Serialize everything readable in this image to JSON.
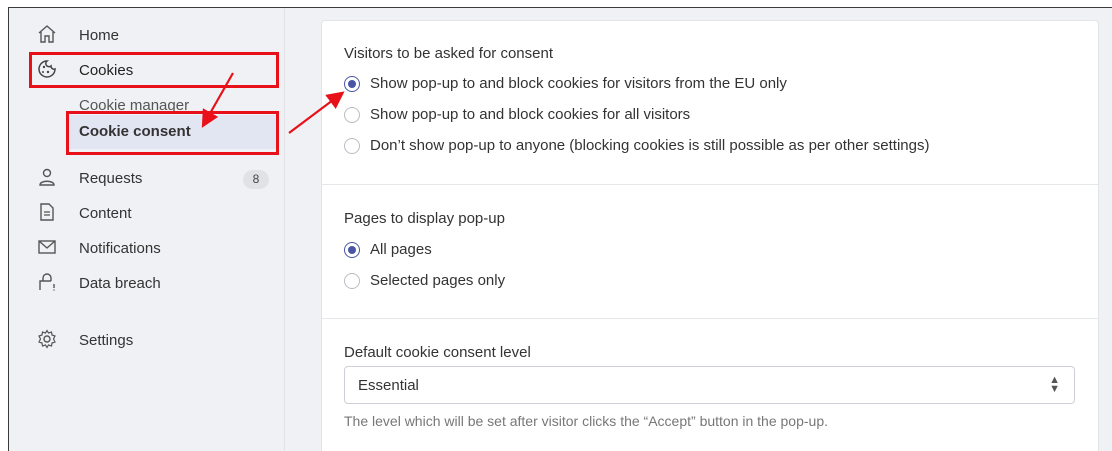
{
  "sidebar": {
    "items": [
      {
        "label": "Home",
        "icon": "home-icon"
      },
      {
        "label": "Cookies",
        "icon": "cookie-icon"
      },
      {
        "label": "Cookie manager"
      },
      {
        "label": "Cookie consent"
      },
      {
        "label": "Requests",
        "icon": "user-icon",
        "badge": "8"
      },
      {
        "label": "Content",
        "icon": "document-icon"
      },
      {
        "label": "Notifications",
        "icon": "envelope-icon"
      },
      {
        "label": "Data breach",
        "icon": "lock-alert-icon"
      },
      {
        "label": "Settings",
        "icon": "gear-icon"
      }
    ]
  },
  "consent": {
    "title": "Visitors to be asked for consent",
    "options": [
      {
        "label": "Show pop-up to and block cookies for visitors from the EU only",
        "selected": true
      },
      {
        "label": "Show pop-up to and block cookies for all visitors",
        "selected": false
      },
      {
        "label": "Don’t show pop-up to anyone (blocking cookies is still possible as per other settings)",
        "selected": false
      }
    ]
  },
  "pages": {
    "title": "Pages to display pop-up",
    "options": [
      {
        "label": "All pages",
        "selected": true
      },
      {
        "label": "Selected pages only",
        "selected": false
      }
    ]
  },
  "level": {
    "title": "Default cookie consent level",
    "value": "Essential",
    "help": "The level which will be set after visitor clicks the “Accept” button in the pop-up."
  },
  "colors": {
    "accent": "#4956a6",
    "highlight": "#e8111a",
    "sidebar_bg": "#f0f1f4",
    "active_bg": "#e2e5f2"
  }
}
